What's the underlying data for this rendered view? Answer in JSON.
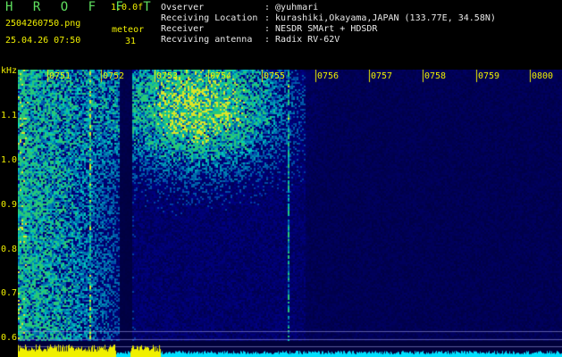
{
  "app": {
    "title": "H R O F F T",
    "version": "1.0.0f",
    "file_name": "2504260750.png",
    "timestamp": "25.04.26 07:50",
    "meteor_label": "meteor",
    "meteor_count": "31"
  },
  "info": [
    {
      "key": "Ovserver",
      "value": ": @yuhmari"
    },
    {
      "key": "Receiving Location",
      "value": ": kurashiki,Okayama,JAPAN (133.77E, 34.58N)"
    },
    {
      "key": "Receiver",
      "value": ": NESDR SMArt + HDSDR"
    },
    {
      "key": "Recviving antenna",
      "value": ": Radix RV-62V"
    }
  ],
  "spectrogram": {
    "unit": "kHz",
    "freq_labels": [
      "1.1",
      "1.0",
      "0.9",
      "0.8",
      "0.7",
      "0.6"
    ],
    "time_labels": [
      "0751",
      "0752",
      "0753",
      "0754",
      "0755",
      "0756",
      "0757",
      "0758",
      "0759",
      "0800"
    ],
    "colors": {
      "label_green": "#5fe05f",
      "label_yellow": "#f0f000",
      "background": "#00003a",
      "tick": "#f0f000",
      "signal": "#00e0ff"
    }
  }
}
